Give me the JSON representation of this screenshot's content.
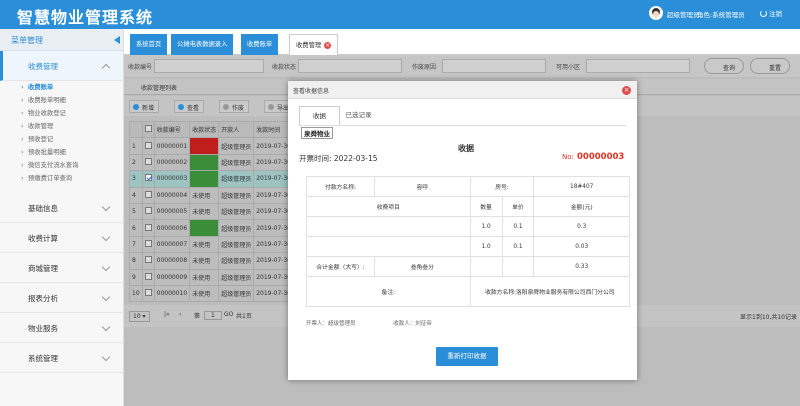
{
  "app": {
    "title": "智慧物业管理系统",
    "user_name": "超级管理员",
    "role_label": "角色:",
    "role_value": "系统管理员",
    "logout": "注销"
  },
  "sidebar": {
    "header": "菜单管理",
    "open_group": "收费管理",
    "items": [
      "收费账单",
      "收费账单明细",
      "物业收款登记",
      "收款管理",
      "预收登记",
      "预收批量明细",
      "微信支付流水查询",
      "预缴费订单查询"
    ],
    "active_index": 0,
    "groups": [
      "基础信息",
      "收费计算",
      "商城管理",
      "报表分析",
      "物业服务",
      "系统管理"
    ]
  },
  "tabs": [
    {
      "label": "系统首页"
    },
    {
      "label": "公摊电表数据录入"
    },
    {
      "label": "收费账单"
    },
    {
      "label": "收费管理"
    }
  ],
  "filter": {
    "l1": "收款编号",
    "l2": "收款状态",
    "l3": "作废原因",
    "l4": "可用小区",
    "search": "查询",
    "reset": "重置"
  },
  "panel_title": "收款管理列表",
  "toolbar": [
    "新增",
    "查看",
    "作废",
    "导出"
  ],
  "grid": {
    "headers": [
      "",
      "",
      "收款编号",
      "收款状态",
      "开款人",
      "发款时间"
    ],
    "rows": [
      {
        "n": "1",
        "id": "00000001",
        "status": "",
        "who": "超级管理员",
        "time": "2019-07-30",
        "cls": "red"
      },
      {
        "n": "2",
        "id": "00000002",
        "status": "",
        "who": "超级管理员",
        "time": "2019-07-30",
        "cls": "green"
      },
      {
        "n": "3",
        "id": "00000003",
        "status": "",
        "who": "超级管理员",
        "time": "2019-07-30",
        "cls": "green",
        "sel": true
      },
      {
        "n": "4",
        "id": "00000004",
        "status": "未使用",
        "who": "超级管理员",
        "time": "2019-07-30",
        "cls": ""
      },
      {
        "n": "5",
        "id": "00000005",
        "status": "未使用",
        "who": "超级管理员",
        "time": "2019-07-30",
        "cls": ""
      },
      {
        "n": "6",
        "id": "00000006",
        "status": "",
        "who": "超级管理员",
        "time": "2019-07-30",
        "cls": "green"
      },
      {
        "n": "7",
        "id": "00000007",
        "status": "未使用",
        "who": "超级管理员",
        "time": "2019-07-30",
        "cls": ""
      },
      {
        "n": "8",
        "id": "00000008",
        "status": "未使用",
        "who": "超级管理员",
        "time": "2019-07-30",
        "cls": ""
      },
      {
        "n": "9",
        "id": "00000009",
        "status": "未使用",
        "who": "超级管理员",
        "time": "2019-07-30",
        "cls": ""
      },
      {
        "n": "10",
        "id": "00000010",
        "status": "未使用",
        "who": "超级管理员",
        "time": "2019-07-30",
        "cls": ""
      }
    ]
  },
  "pager": {
    "size": "10",
    "page_label": "第",
    "page": "1",
    "total": "共1页",
    "go": "GO",
    "info": "显示1到10,共10记录"
  },
  "modal": {
    "title": "查看收据信息",
    "tab_active": "收据",
    "tab_other": "已选记录",
    "logo": "泉舜物业",
    "receipt_title": "收据",
    "open_time": "开票时间: 2022-03-15",
    "no_label": "No:",
    "no_value": "00000003",
    "payer_label": "付款方名称:",
    "payer_value": "容呼",
    "room_label": "房号:",
    "room_value": "18#407",
    "item_header": "收费项目",
    "qty_header": "数量",
    "price_header": "单价",
    "amount_header": "金额(元)",
    "lines": [
      {
        "qty": "1.0",
        "price": "0.1",
        "amount": "0.3"
      },
      {
        "qty": "1.0",
        "price": "0.1",
        "amount": "0.03"
      }
    ],
    "total_label": "合计金额（大写）:",
    "total_cn": "叁角叁分",
    "total_value": "0.33",
    "remark_label": "备注:",
    "payee": "收款方名称:洛阳泉舜物业服务有限公司西门分公司",
    "issuer": "开票人：超级管理员",
    "receiver": "收款人：刘征帝",
    "reprint": "重新打印收据"
  }
}
